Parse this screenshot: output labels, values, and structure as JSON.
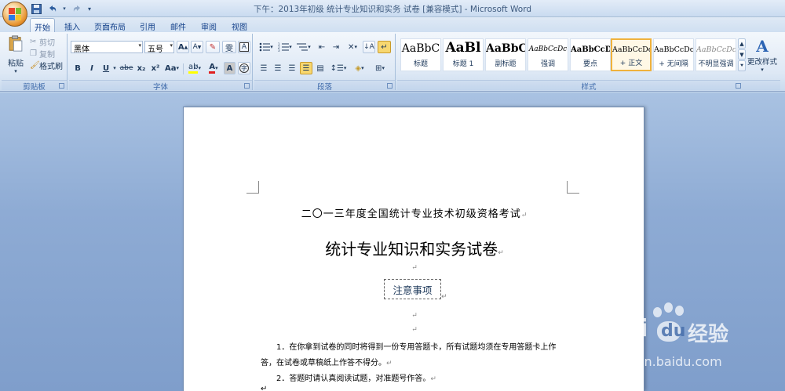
{
  "window": {
    "title": "下午：2013年初级 统计专业知识和实务 试卷 [兼容模式] - Microsoft Word"
  },
  "quick_access": {
    "save_icon": "save-icon",
    "undo_icon": "undo-icon",
    "redo_icon": "redo-icon",
    "more": "▾"
  },
  "tabs": [
    "开始",
    "插入",
    "页面布局",
    "引用",
    "邮件",
    "审阅",
    "视图"
  ],
  "ribbon": {
    "clipboard": {
      "label": "剪贴板",
      "paste": "粘贴",
      "cut": "剪切",
      "copy": "复制",
      "format_painter": "格式刷"
    },
    "font": {
      "label": "字体",
      "font_name": "黑体",
      "font_size": "五号",
      "grow": "A",
      "shrink": "A",
      "bold": "B",
      "italic": "I",
      "underline": "U",
      "strike": "abe",
      "subscript": "x₂",
      "superscript": "x²",
      "change_case": "Aa",
      "font_color": "A",
      "char_shading": "A",
      "char_border": "A",
      "phonetic": "雯"
    },
    "paragraph": {
      "label": "段落"
    },
    "styles": {
      "label": "样式",
      "change_styles": "更改样式",
      "items": [
        {
          "sample": "AaBbC",
          "name": "标题"
        },
        {
          "sample": "AaBl",
          "name": "标题 1"
        },
        {
          "sample": "AaBbC",
          "name": "副标题"
        },
        {
          "sample": "AaBbCcDc",
          "name": "强调"
        },
        {
          "sample": "AaBbCcD",
          "name": "要点"
        },
        {
          "sample": "AaBbCcDc",
          "name": "+ 正文"
        },
        {
          "sample": "AaBbCcDc",
          "name": "+ 无间隔"
        },
        {
          "sample": "AaBbCcDc",
          "name": "不明显强调"
        }
      ]
    }
  },
  "document": {
    "line1": "二〇一三年度全国统计专业技术初级资格考试",
    "line2": "统计专业知识和实务试卷",
    "notice": "注意事项",
    "para1a": "1．在你拿到试卷的同时将得到一份专用答题卡，所有试题均须在专用答题卡上作",
    "para1b": "答，在试卷或草稿纸上作答不得分。",
    "para2": "2．答题时请认真阅读试题，对准题号作答。",
    "pilcrow": "↵"
  },
  "watermark": {
    "brand": "Bai",
    "brand2": "du",
    "product": "经验",
    "url": "jingyan.baidu.com"
  }
}
